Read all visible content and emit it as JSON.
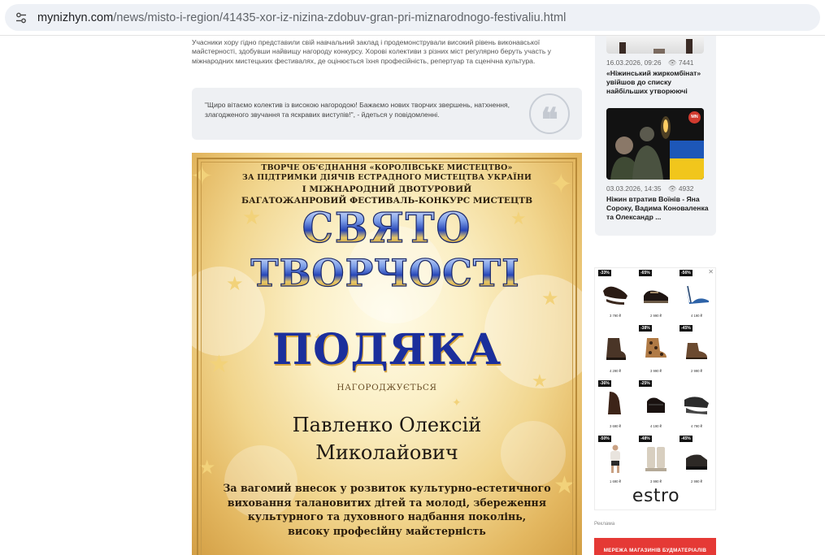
{
  "browser": {
    "url_host": "mynizhyn.com",
    "url_path": "/news/misto-i-region/41435-xor-iz-nizina-zdobuv-gran-pri-miznarodnogo-festivaliu.html",
    "site_info_icon": "tune-icon"
  },
  "article": {
    "intro": "Учасники хору гідно представили свій навчальний заклад і продемонстрували високий рівень виконавської майстерності, здобувши найвищу нагороду конкурсу. Хорові колективи з різних міст регулярно беруть участь у міжнародних мистецьких фестивалях, де оцінюється їхня професійність, репертуар та сценічна культура.",
    "quote": "\"Щиро вітаємо колектив із високою нагородою! Бажаємо нових творчих звершень, натхнення, злагодженого звучання та яскравих виступів!\", - йдеться у повідомленні.",
    "quote_icon": "quote-icon"
  },
  "certificate": {
    "org_line1": "ТВОРЧЕ ОБ'ЄДНАННЯ «КОРОЛІВСЬКЕ МИСТЕЦТВО»",
    "org_line2": "ЗА ПІДТРИМКИ ДІЯЧІВ ЕСТРАДНОГО МИСТЕЦТВА УКРАЇНИ",
    "fest_line1": "І МІЖНАРОДНИЙ ДВОТУРОВИЙ",
    "fest_line2": "БАГАТОЖАНРОВИЙ ФЕСТИВАЛЬ-КОНКУРС МИСТЕЦТВ",
    "title_line1": "СВЯТО",
    "title_line2": "ТВОРЧОСТІ",
    "heading": "ПОДЯКА",
    "awarded": "НАГОРОДЖУЄТЬСЯ",
    "name_line1": "Павленко Олексій",
    "name_line2": "Миколайович",
    "merit_line1": "За вагомий внесок у розвиток культурно-естетичного",
    "merit_line2": "виховання талановитих дітей та молоді, збереження",
    "merit_line3": "культурного та духовного надбання поколінь,",
    "merit_line4": "високу професійну майстерність"
  },
  "sidebar": {
    "news": [
      {
        "date": "16.03.2026, 09:26",
        "views": "7441",
        "title": "«Ніжинський жиркомбінат» увійшов до списку найбільших утворюючі"
      },
      {
        "date": "03.03.2026, 14:35",
        "views": "4932",
        "title": "Ніжин втратив Воїнів - Яна Сороку, Вадима Коноваленка та Олександр ..."
      }
    ],
    "views_icon": "eye-icon",
    "thumb_badge": "MN"
  },
  "ad": {
    "close_label": "✕",
    "brand": "estro",
    "products": [
      {
        "discount": "-33%",
        "price": "3 790 ₴"
      },
      {
        "discount": "-65%",
        "price": "2 990 ₴"
      },
      {
        "discount": "-56%",
        "price": "4 190 ₴"
      },
      {
        "discount": "",
        "price": "4 290 ₴"
      },
      {
        "discount": "-38%",
        "price": "3 990 ₴"
      },
      {
        "discount": "-45%",
        "price": "2 990 ₴"
      },
      {
        "discount": "-36%",
        "price": "3 690 ₴"
      },
      {
        "discount": "-25%",
        "price": "4 190 ₴"
      },
      {
        "discount": "",
        "price": "4 790 ₴"
      },
      {
        "discount": "-50%",
        "price": "1 690 ₴"
      },
      {
        "discount": "-48%",
        "price": "3 990 ₴"
      },
      {
        "discount": "-45%",
        "price": "2 990 ₴"
      }
    ],
    "label": "Реклама",
    "banner_text": "МЕРЕЖА МАГАЗИНІВ БУДМАТЕРІАЛІВ"
  }
}
